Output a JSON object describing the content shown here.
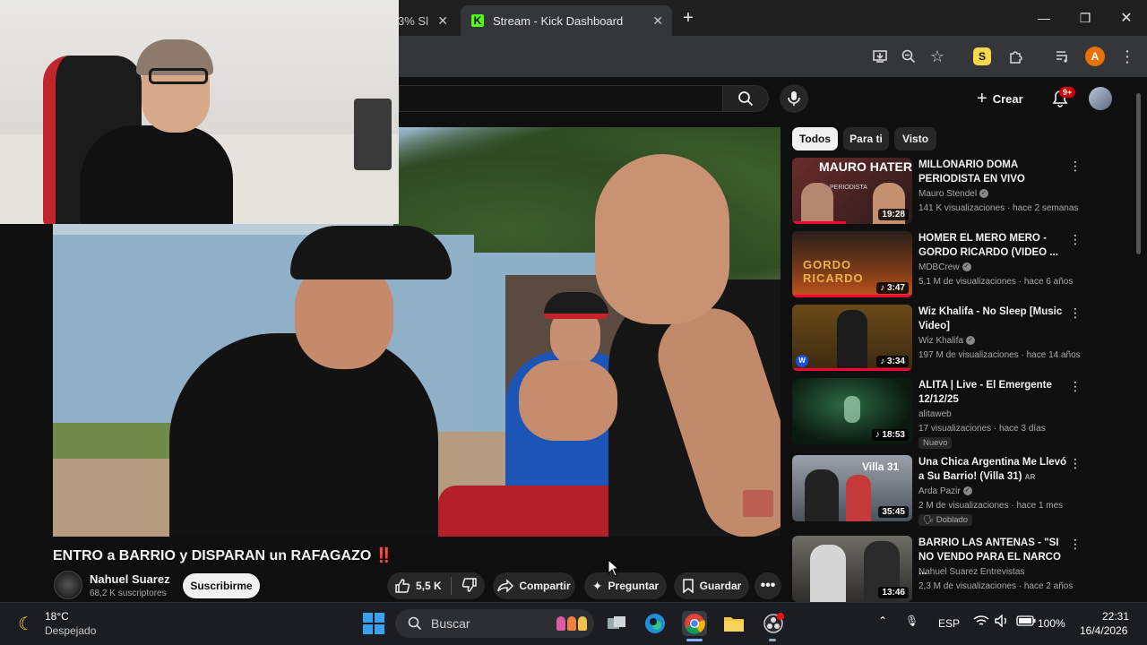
{
  "browser": {
    "tabs": [
      {
        "label": "3% Sl"
      },
      {
        "label": "Stream - Kick Dashboard"
      }
    ],
    "profile_initial": "A"
  },
  "youtube": {
    "header": {
      "create_label": "Crear",
      "notification_count": "9+"
    },
    "video": {
      "title": "ENTRO a BARRIO y DISPARAN un RAFAGAZO",
      "title_emoji": "‼️",
      "channel": "Nahuel Suarez",
      "subscribers": "68,2 K suscriptores",
      "subscribe_label": "Suscribirme",
      "likes": "5,5 K",
      "share_label": "Compartir",
      "ask_label": "Preguntar",
      "save_label": "Guardar"
    },
    "chips": [
      {
        "label": "Todos",
        "active": true
      },
      {
        "label": "Para ti",
        "active": false
      },
      {
        "label": "Visto",
        "active": false
      }
    ],
    "recommendations": [
      {
        "title": "MILLONARIO DOMA PERIODISTA EN VIVO",
        "channel": "Mauro Stendel",
        "verified": true,
        "meta": "141 K visualizaciones · hace 2 semanas",
        "duration": "19:28",
        "badge": "",
        "thumb_text": "MAURO HATER",
        "thumb_sub": "PERIODISTA",
        "thumb_color": "#5a2a2a"
      },
      {
        "title": "HOMER EL MERO MERO - GORDO RICARDO (VIDEO ...",
        "channel": "MDBCrew",
        "verified": true,
        "meta": "5,1 M de visualizaciones · hace 6 años",
        "duration": "♪ 3:47",
        "badge": "",
        "thumb_text": "GORDO RICARDO",
        "thumb_sub": "",
        "thumb_color": "#3a2a1f"
      },
      {
        "title": "Wiz Khalifa - No Sleep [Music Video]",
        "channel": "Wiz Khalifa",
        "verified": true,
        "meta": "197 M de visualizaciones · hace 14 años",
        "duration": "♪ 3:34",
        "badge": "",
        "thumb_text": "",
        "thumb_sub": "",
        "thumb_color": "#3d2a14"
      },
      {
        "title": "ALITA | Live - El Emergente 12/12/25",
        "channel": "alitaweb",
        "verified": false,
        "meta": "17 visualizaciones · hace 3 días",
        "duration": "♪ 18:53",
        "badge": "Nuevo",
        "thumb_text": "",
        "thumb_sub": "",
        "thumb_color": "#0f2418"
      },
      {
        "title": "Una Chica Argentina Me Llevó a Su Barrio! (Villa 31)",
        "title_suffix": "AR",
        "channel": "Arda Pazir",
        "verified": true,
        "meta": "2 M de visualizaciones · hace 1 mes",
        "duration": "35:45",
        "badge": "Doblado",
        "thumb_text": "Villa 31",
        "thumb_sub": "",
        "thumb_color": "#5f6670"
      },
      {
        "title": "BARRIO LAS ANTENAS - \"SI NO VENDO PARA EL NARCO ...",
        "channel": "Nahuel Suarez Entrevistas",
        "verified": false,
        "meta": "2,3 M de visualizaciones · hace 2 años",
        "duration": "13:46",
        "badge": "",
        "thumb_text": "",
        "thumb_sub": "",
        "thumb_color": "#4a4a48"
      }
    ]
  },
  "taskbar": {
    "temperature": "18°C",
    "condition": "Despejado",
    "search_placeholder": "Buscar",
    "language": "ESP",
    "battery": "100%",
    "time": "22:31",
    "date": "16/4/2026"
  },
  "colors": {
    "youtube_red": "#ff0033",
    "kick_green": "#53fc18",
    "background": "#0f0f0f"
  }
}
